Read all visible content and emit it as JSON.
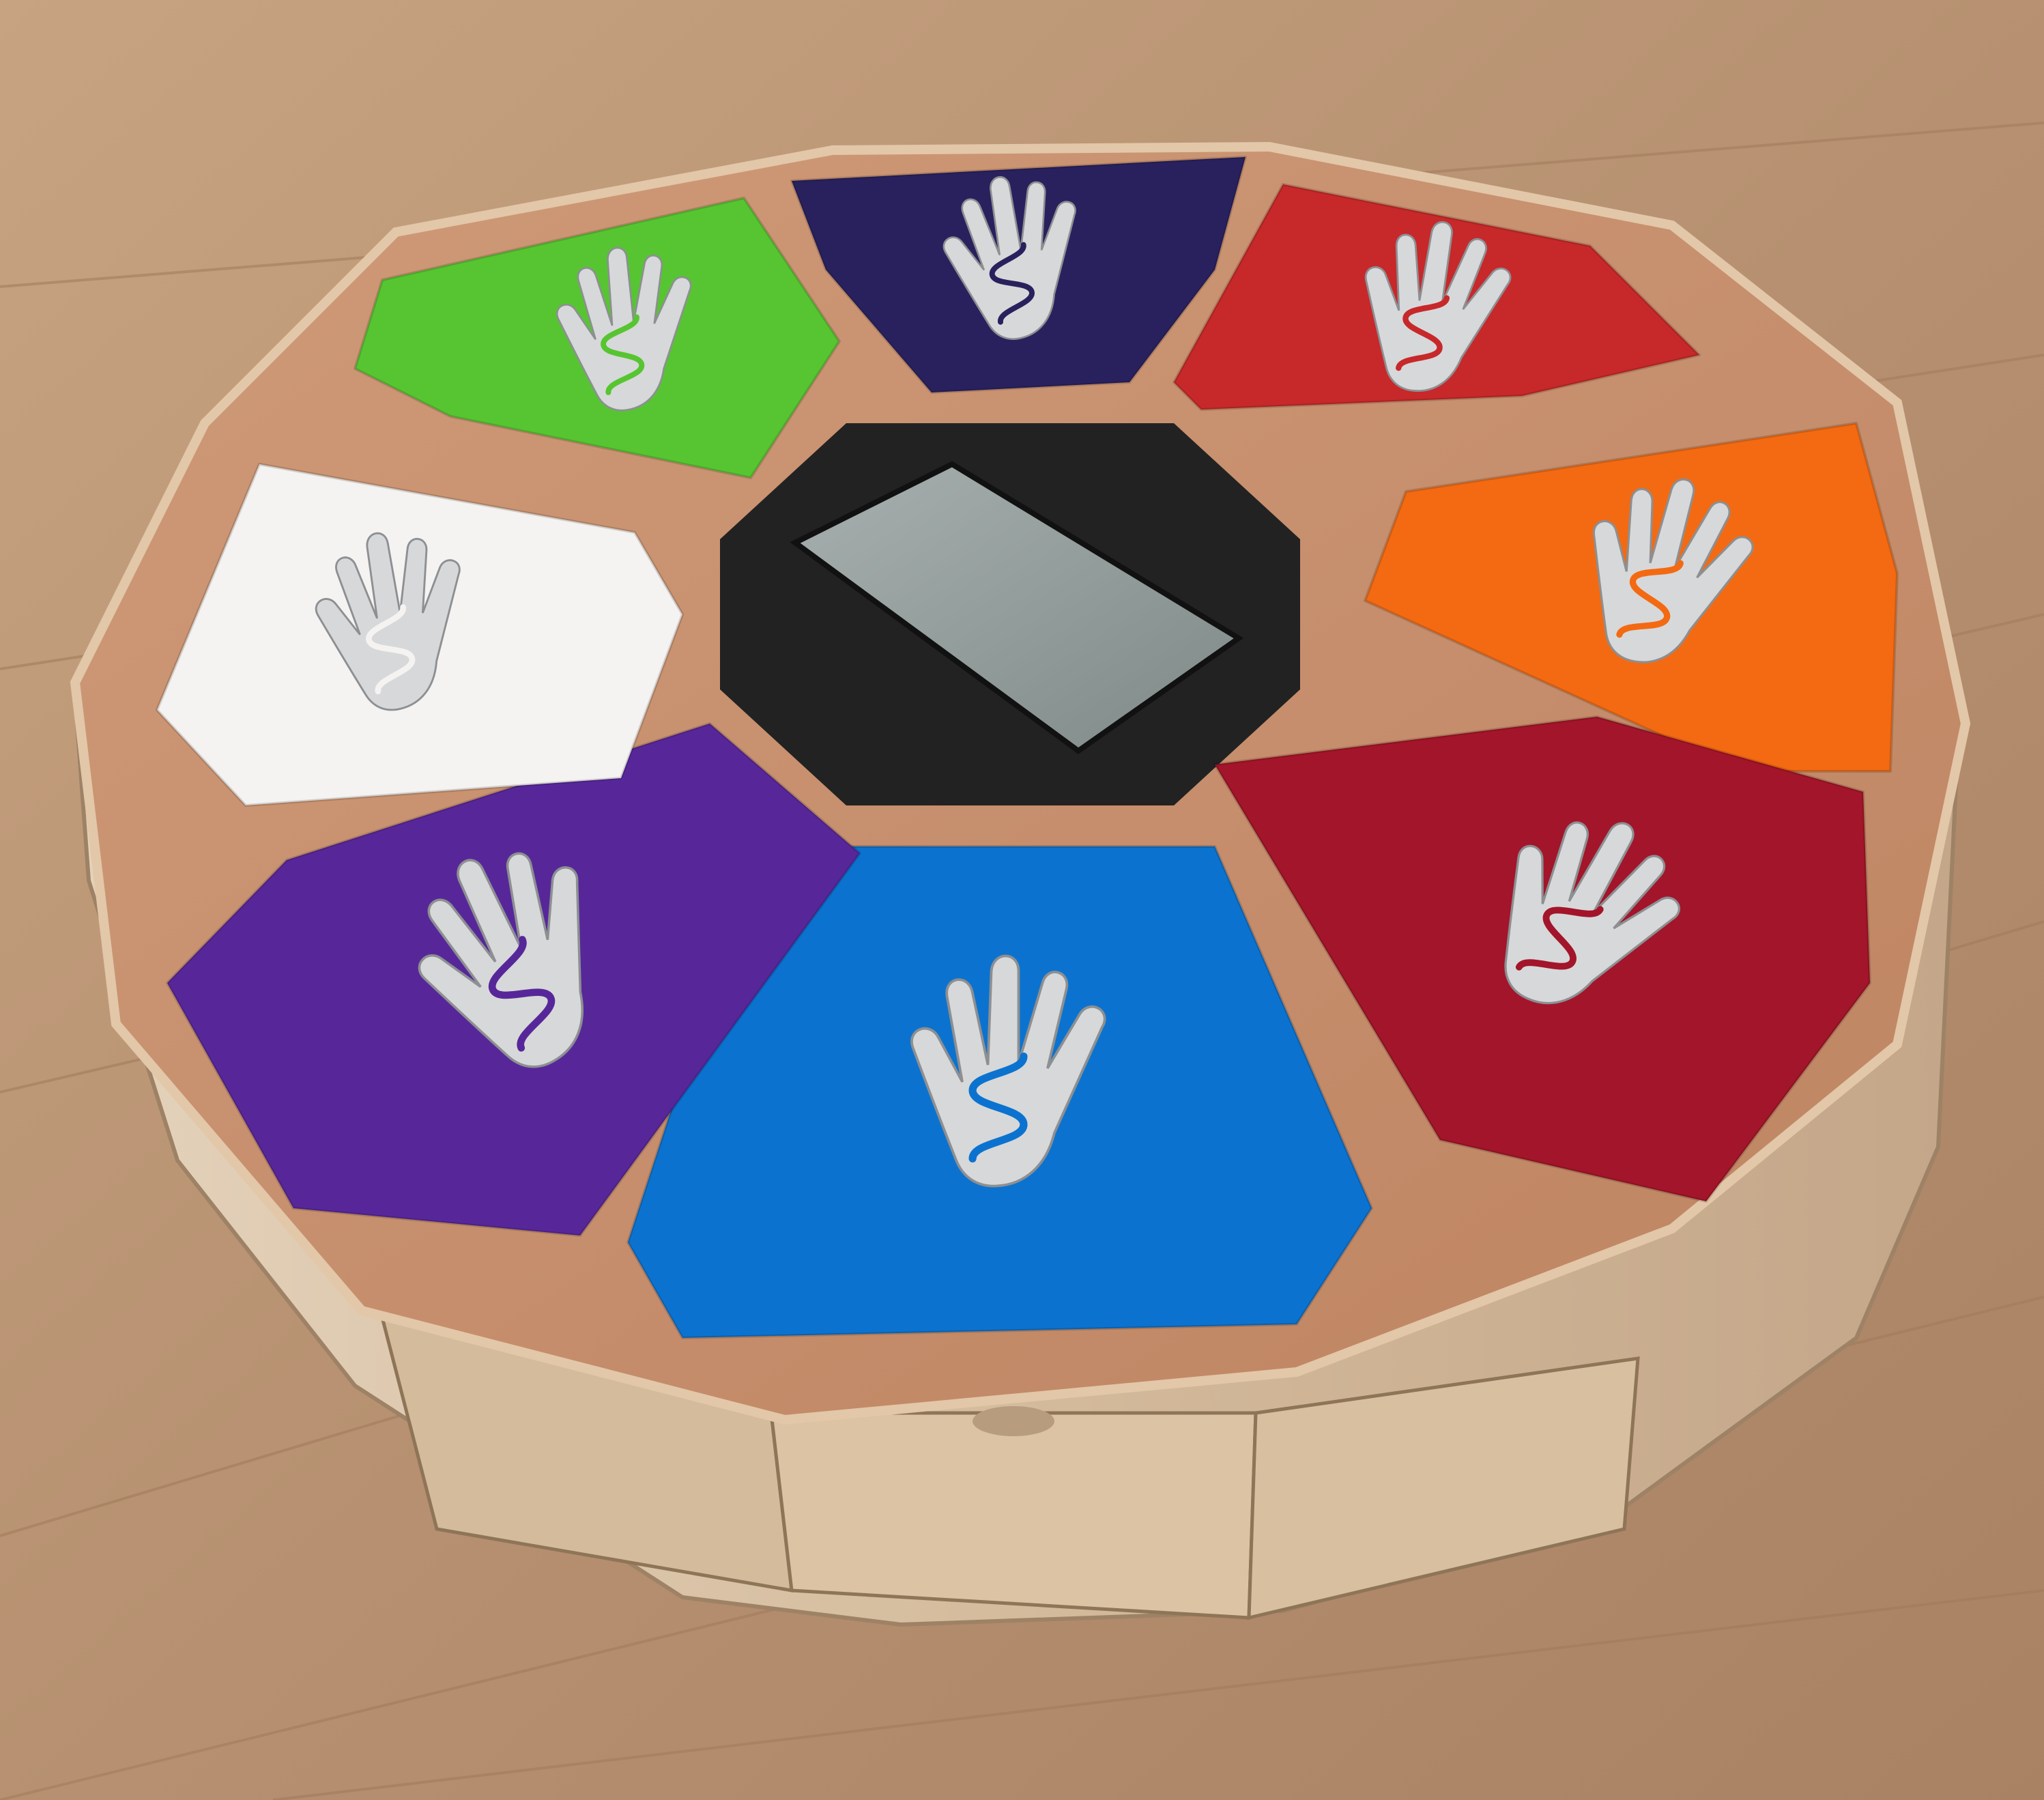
{
  "scene": {
    "subject": "wooden-dodecagon-touch-box",
    "floor_color": "#b99474",
    "floor_color_light": "#c9a886",
    "wood_top_color": "#c48e6c",
    "wood_edge_color": "#d4b693",
    "wood_side_color": "#cdb49a",
    "drawer_color": "#d9bf9f"
  },
  "center_panel": {
    "name": "center-screen",
    "frame_color": "#222222",
    "screen_color": "#8f9a98"
  },
  "pads": [
    {
      "name": "pad-navy",
      "color": "#29215e",
      "icon": "hand-icon"
    },
    {
      "name": "pad-red",
      "color": "#c7282a",
      "icon": "hand-icon"
    },
    {
      "name": "pad-orange",
      "color": "#f36a12",
      "icon": "hand-icon"
    },
    {
      "name": "pad-crimson",
      "color": "#a3152a",
      "icon": "hand-icon"
    },
    {
      "name": "pad-blue",
      "color": "#0b73cf",
      "icon": "hand-icon"
    },
    {
      "name": "pad-purple",
      "color": "#57279a",
      "icon": "hand-icon"
    },
    {
      "name": "pad-white",
      "color": "#f4f3f1",
      "icon": "hand-icon"
    },
    {
      "name": "pad-green",
      "color": "#56c531",
      "icon": "hand-icon"
    }
  ],
  "icon_metal_color": "#d7d8d9"
}
